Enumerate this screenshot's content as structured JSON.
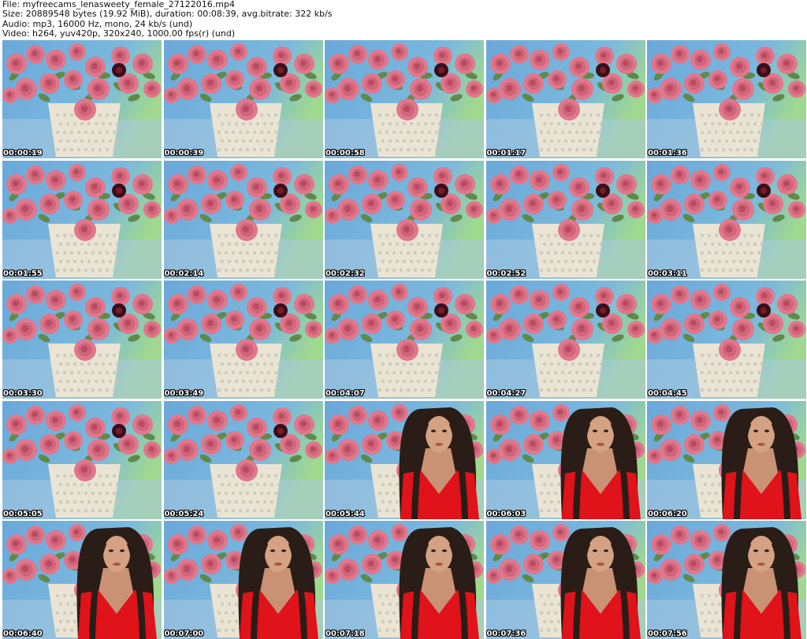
{
  "header": {
    "file_line": "File: myfreecams_lenasweety_female_27122016.mp4",
    "size_line": "Size: 20889548 bytes (19.92 MiB), duration: 00:08:39, avg.bitrate: 322 kb/s",
    "audio_line": "Audio: mp3, 16000 Hz, mono, 24 kb/s (und)",
    "video_line": "Video: h264, yuv420p, 320x240, 1000.00 fps(r) (und)"
  },
  "colors": {
    "sky_blue": "#6aa8da",
    "mint_green": "#9fd88f",
    "rose_pink": "#e0778c",
    "rose_dark": "#b84a62",
    "leaf_green": "#5e8a4a",
    "vase_cream": "#e9e4d4",
    "dress_red": "#e0121a",
    "hair_dark": "#2a1d17",
    "skin": "#c99274"
  },
  "thumbnails": [
    {
      "time": "00:00:19",
      "person": false
    },
    {
      "time": "00:00:39",
      "person": false
    },
    {
      "time": "00:00:58",
      "person": false
    },
    {
      "time": "00:01:17",
      "person": false
    },
    {
      "time": "00:01:36",
      "person": false
    },
    {
      "time": "00:01:55",
      "person": false
    },
    {
      "time": "00:02:14",
      "person": false
    },
    {
      "time": "00:02:32",
      "person": false
    },
    {
      "time": "00:02:52",
      "person": false
    },
    {
      "time": "00:03:11",
      "person": false
    },
    {
      "time": "00:03:30",
      "person": false
    },
    {
      "time": "00:03:49",
      "person": false
    },
    {
      "time": "00:04:07",
      "person": false
    },
    {
      "time": "00:04:27",
      "person": false
    },
    {
      "time": "00:04:45",
      "person": false
    },
    {
      "time": "00:05:05",
      "person": false
    },
    {
      "time": "00:05:24",
      "person": false
    },
    {
      "time": "00:05:44",
      "person": true
    },
    {
      "time": "00:06:03",
      "person": true
    },
    {
      "time": "00:06:20",
      "person": true
    },
    {
      "time": "00:06:40",
      "person": true
    },
    {
      "time": "00:07:00",
      "person": true
    },
    {
      "time": "00:07:18",
      "person": true
    },
    {
      "time": "00:07:36",
      "person": true
    },
    {
      "time": "00:07:56",
      "person": true
    }
  ]
}
